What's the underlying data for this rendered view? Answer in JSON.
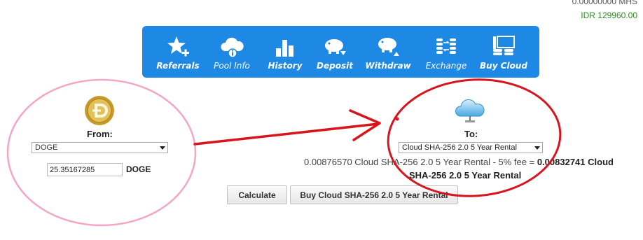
{
  "balances": {
    "mhs": "0.00000000 MHS",
    "idr": "IDR 129960.00"
  },
  "toolbar": {
    "items": [
      {
        "label": "Referrals",
        "icon": "star-plus-icon"
      },
      {
        "label": "Pool Info",
        "icon": "cloud-info-icon"
      },
      {
        "label": "History",
        "icon": "bar-chart-icon"
      },
      {
        "label": "Deposit",
        "icon": "piggy-bank-down-icon"
      },
      {
        "label": "Withdraw",
        "icon": "piggy-bank-up-icon"
      },
      {
        "label": "Exchange",
        "icon": "exchange-coins-icon"
      },
      {
        "label": "Buy Cloud",
        "icon": "cloud-server-icon"
      }
    ]
  },
  "from": {
    "label": "From:",
    "selected": "DOGE",
    "amount": "25.35167285",
    "unit": "DOGE",
    "coin_icon": "dogecoin-icon"
  },
  "to": {
    "label": "To:",
    "selected": "Cloud SHA-256 2.0 5 Year Rental",
    "icon": "cloud-icon"
  },
  "conversion": {
    "line1_prefix": "0.00876570 Cloud SHA-256 2.0 5 Year Rental - 5% fee = ",
    "line1_bold": "0.00832741 Cloud",
    "line2": "SHA-256 2.0 5 Year Rental"
  },
  "buttons": {
    "calculate": "Calculate",
    "buy": "Buy Cloud SHA-256 2.0 5 Year Rental"
  },
  "colors": {
    "toolbar": "#1e88e5",
    "idr": "#2e8b22",
    "annotation_pink": "#f4a6c8",
    "annotation_red": "#d8141c"
  }
}
